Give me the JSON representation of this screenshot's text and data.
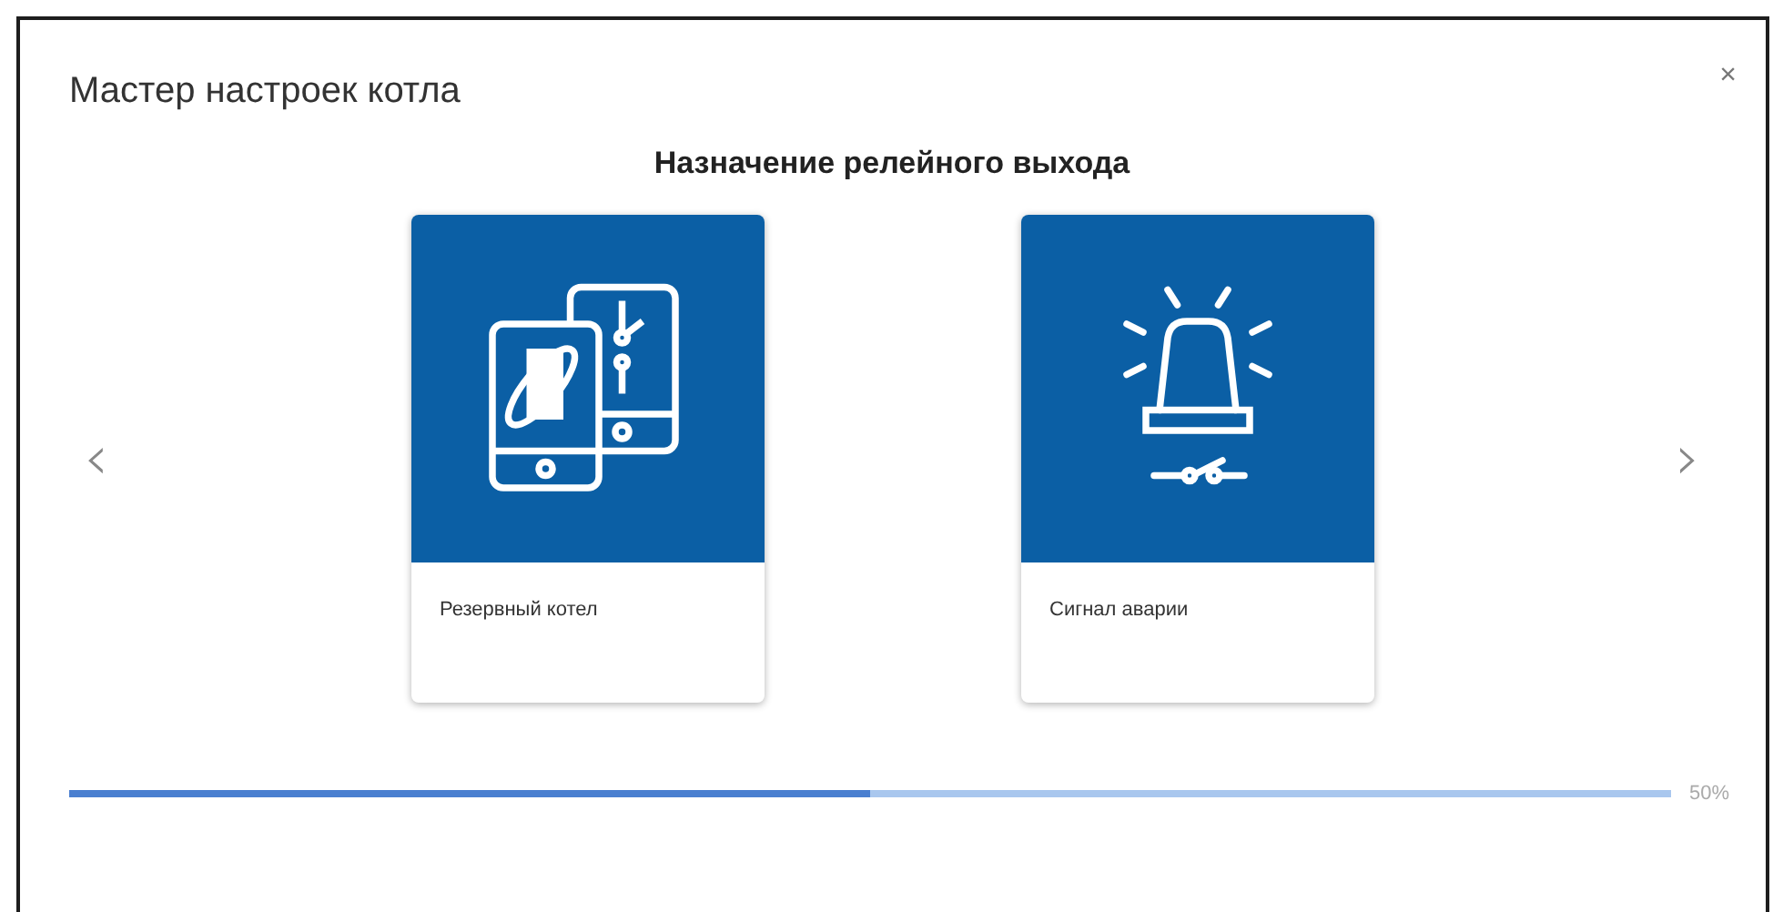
{
  "dialog": {
    "title": "Мастер настроек котла",
    "close": "×"
  },
  "step": {
    "heading": "Назначение релейного выхода",
    "prev": "‹",
    "next": "›"
  },
  "options": [
    {
      "kind": "reserve",
      "label": "Резервный котел"
    },
    {
      "kind": "alarm",
      "label": "Сигнал аварии"
    }
  ],
  "progress": {
    "level": 0.5,
    "reading": "50%"
  }
}
